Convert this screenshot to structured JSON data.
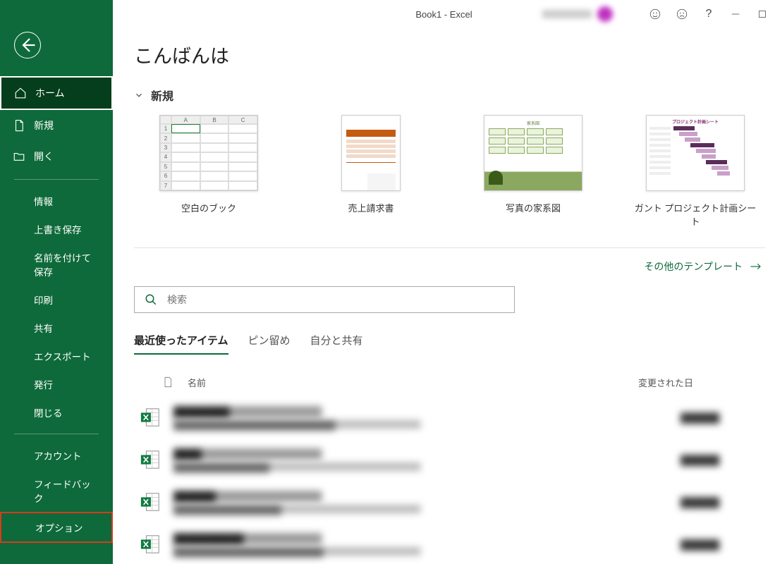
{
  "title": "Book1  -  Excel",
  "greeting": "こんばんは",
  "sidebar": {
    "home": "ホーム",
    "new": "新規",
    "open": "開く",
    "info": "情報",
    "save": "上書き保存",
    "saveas": "名前を付けて保存",
    "print": "印刷",
    "share": "共有",
    "export": "エクスポート",
    "publish": "発行",
    "close": "閉じる",
    "account": "アカウント",
    "feedback": "フィードバック",
    "options": "オプション"
  },
  "section": {
    "new": "新規"
  },
  "templates": [
    {
      "label": "空白のブック"
    },
    {
      "label": "売上請求書"
    },
    {
      "label": "写真の家系図"
    },
    {
      "label": "ガント プロジェクト計画シート"
    }
  ],
  "more": "その他のテンプレート",
  "search": {
    "placeholder": "検索"
  },
  "tabs": {
    "recent": "最近使ったアイテム",
    "pinned": "ピン留め",
    "shared": "自分と共有"
  },
  "columns": {
    "name": "名前",
    "modified": "変更された日"
  },
  "files": [
    {
      "name": "████████",
      "path": "███████████████████████████",
      "date": "██████"
    },
    {
      "name": "████",
      "path": "████████████████",
      "date": "██████"
    },
    {
      "name": "██████",
      "path": "██████████████████",
      "date": "██████"
    },
    {
      "name": "██████████",
      "path": "█████████████████████████",
      "date": "██████"
    }
  ]
}
